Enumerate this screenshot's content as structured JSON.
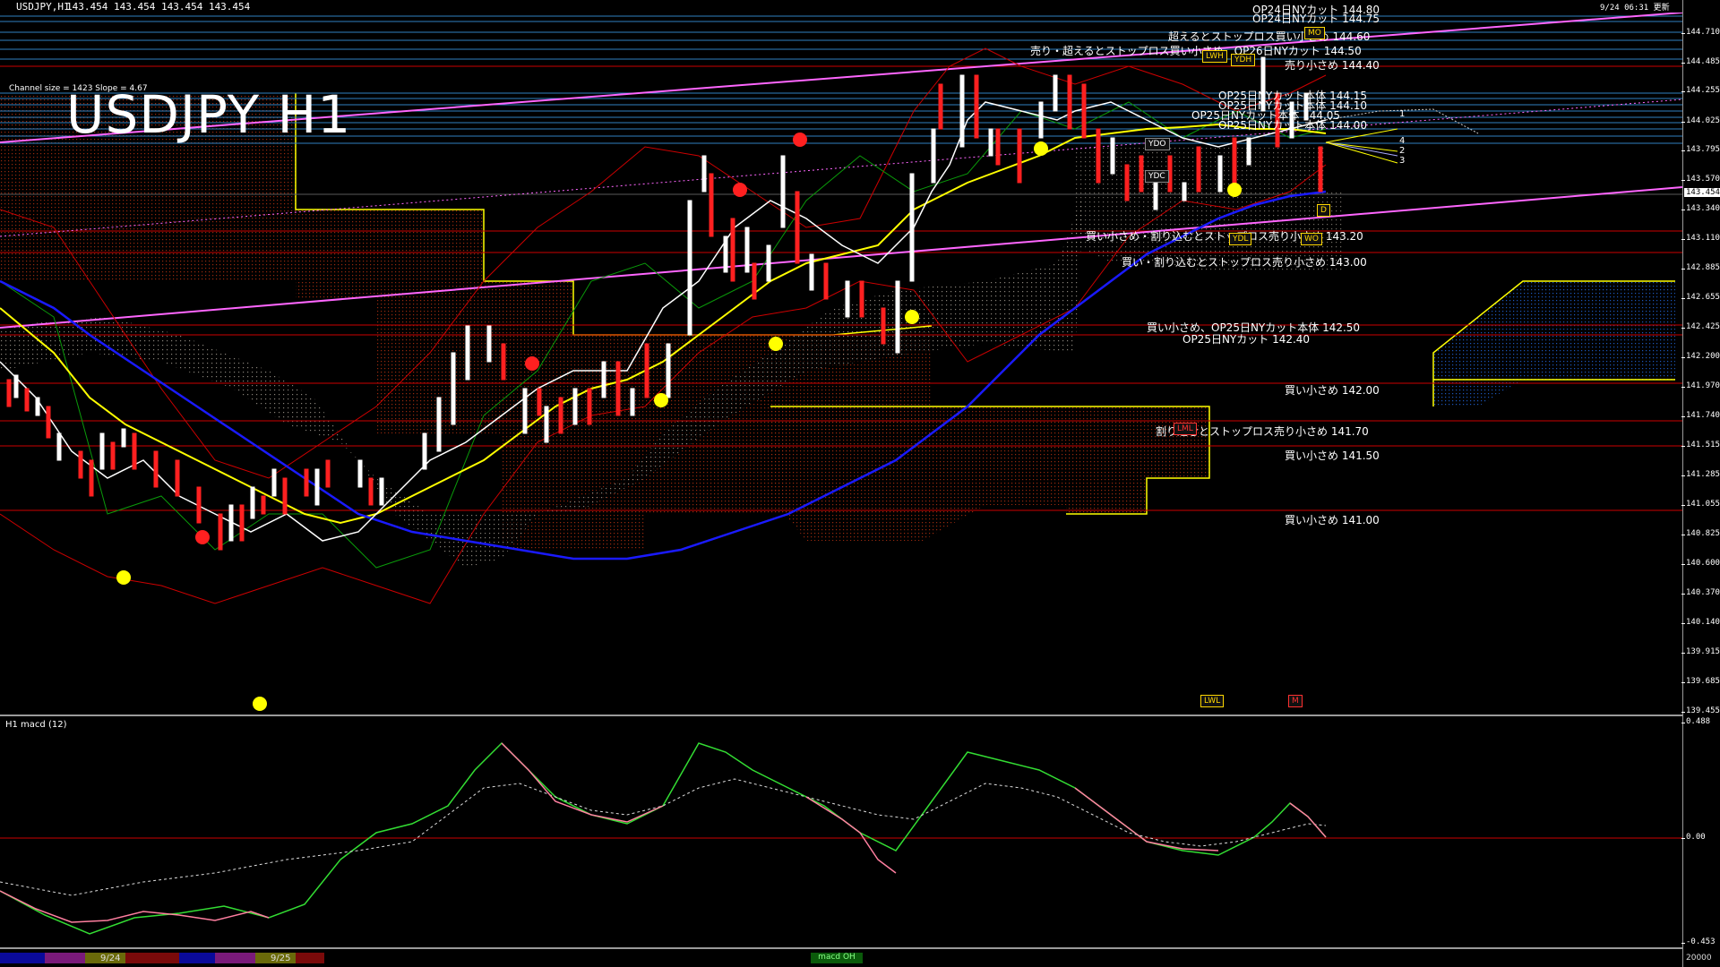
{
  "window": {
    "header_symbol": "USDJPY,H1",
    "header_ohlc": "143.454 143.454 143.454 143.454",
    "datetime": "9/24 06:31 更新"
  },
  "overlay": {
    "title": "USDJPY H1",
    "channel_info": "Channel size = 1423 Slope = 4.67"
  },
  "price_axis": {
    "ticks": [
      "144.710",
      "144.485",
      "144.255",
      "144.025",
      "143.795",
      "143.570",
      "143.340",
      "143.110",
      "142.885",
      "142.655",
      "142.425",
      "142.200",
      "141.970",
      "141.740",
      "141.515",
      "141.285",
      "141.055",
      "140.825",
      "140.600",
      "140.370",
      "140.140",
      "139.915",
      "139.685",
      "139.455"
    ],
    "current_price": "143.454"
  },
  "macd_axis": {
    "ticks": [
      "0.488",
      "0.00",
      "-0.453"
    ]
  },
  "macd_panel": {
    "title": "H1 macd (12)"
  },
  "level_annotations": [
    {
      "text": "OP24日NYカット 144.80",
      "key": "op24a"
    },
    {
      "text": "OP24日NYカット 144.75",
      "key": "op24b"
    },
    {
      "text": "超えるとストップロス買い小さめ 144.60",
      "key": "l1460"
    },
    {
      "text": "売り・超えるとストップロス買い小さめ、OP26日NYカット 144.50",
      "key": "l1450"
    },
    {
      "text": "売り小さめ 144.40",
      "key": "l1440"
    },
    {
      "text": "OP25日NYカット本体 144.15",
      "key": "l1415"
    },
    {
      "text": "OP25日NYカット本体 144.10",
      "key": "l1410"
    },
    {
      "text": "OP25日NYカット本体 144.05",
      "key": "l1405"
    },
    {
      "text": "OP25日NYカット本体 144.00",
      "key": "l1400"
    },
    {
      "text": "買い小さめ・割り込むとストップロス売り小さめ 143.20",
      "key": "l1320"
    },
    {
      "text": "買い・割り込むとストップロス売り小さめ 143.00",
      "key": "l1300"
    },
    {
      "text": "買い小さめ、OP25日NYカット本体 142.50",
      "key": "l1250"
    },
    {
      "text": "OP25日NYカット 142.40",
      "key": "l1240"
    },
    {
      "text": "買い小さめ 142.00",
      "key": "l1200"
    },
    {
      "text": "割り込むとストップロス売り小さめ 141.70",
      "key": "l1170"
    },
    {
      "text": "買い小さめ 141.50",
      "key": "l1150"
    },
    {
      "text": "買い小さめ 141.00",
      "key": "l1100"
    }
  ],
  "box_labels": {
    "ydo": "YDO",
    "ydc": "YDC",
    "ydh": "YDH",
    "ydl": "YDL",
    "lwh": "LWH",
    "lwl": "LWL",
    "lml": "LML",
    "d": "D",
    "m": "M",
    "wo": "WO",
    "mo": "MO"
  },
  "fan_labels": [
    "1",
    "2",
    "3",
    "4"
  ],
  "bottom_bar": {
    "date1": "9/24",
    "date2": "9/25",
    "macd_tab": "macd OH",
    "right_value": "20000"
  },
  "colors": {
    "bull": "#ffffff",
    "bear": "#ff2020",
    "ma_fast": "#ffffff",
    "ma_mid": "#ffff00",
    "ma_slow": "#1a1aff",
    "channel": "#ff66ff",
    "level_red": "#cc0000",
    "level_blue": "#2f7fbf",
    "macd_up": "#33dd33",
    "macd_down": "#ff7fa0"
  }
}
